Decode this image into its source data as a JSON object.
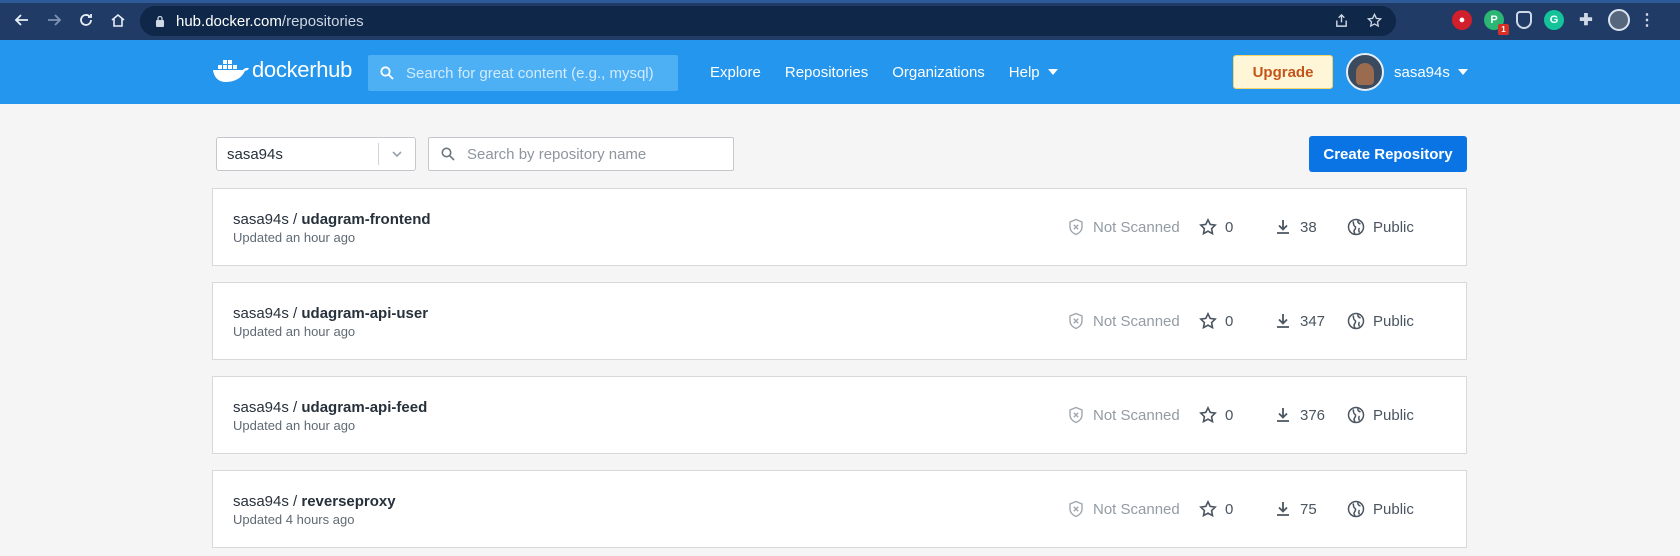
{
  "browser": {
    "url_host": "hub.docker.com",
    "url_path": "/repositories",
    "extension_badge": "1"
  },
  "header": {
    "logo_word_1": "docker",
    "logo_word_2": "hub",
    "search_placeholder": "Search for great content (e.g., mysql)",
    "nav": [
      "Explore",
      "Repositories",
      "Organizations",
      "Help"
    ],
    "upgrade_label": "Upgrade",
    "username": "sasa94s"
  },
  "filters": {
    "namespace": "sasa94s",
    "search_placeholder": "Search by repository name",
    "create_label": "Create Repository"
  },
  "repositories": [
    {
      "owner": "sasa94s / ",
      "name": "udagram-frontend",
      "updated": "Updated an hour ago",
      "scan": "Not Scanned",
      "stars": "0",
      "pulls": "38",
      "visibility": "Public"
    },
    {
      "owner": "sasa94s / ",
      "name": "udagram-api-user",
      "updated": "Updated an hour ago",
      "scan": "Not Scanned",
      "stars": "0",
      "pulls": "347",
      "visibility": "Public"
    },
    {
      "owner": "sasa94s / ",
      "name": "udagram-api-feed",
      "updated": "Updated an hour ago",
      "scan": "Not Scanned",
      "stars": "0",
      "pulls": "376",
      "visibility": "Public"
    },
    {
      "owner": "sasa94s / ",
      "name": "reverseproxy",
      "updated": "Updated 4 hours ago",
      "scan": "Not Scanned",
      "stars": "0",
      "pulls": "75",
      "visibility": "Public"
    }
  ],
  "colors": {
    "brand_blue": "#2496ed",
    "primary_button": "#0b74e5",
    "upgrade_bg": "#fff6d8",
    "upgrade_text": "#c4551a"
  }
}
